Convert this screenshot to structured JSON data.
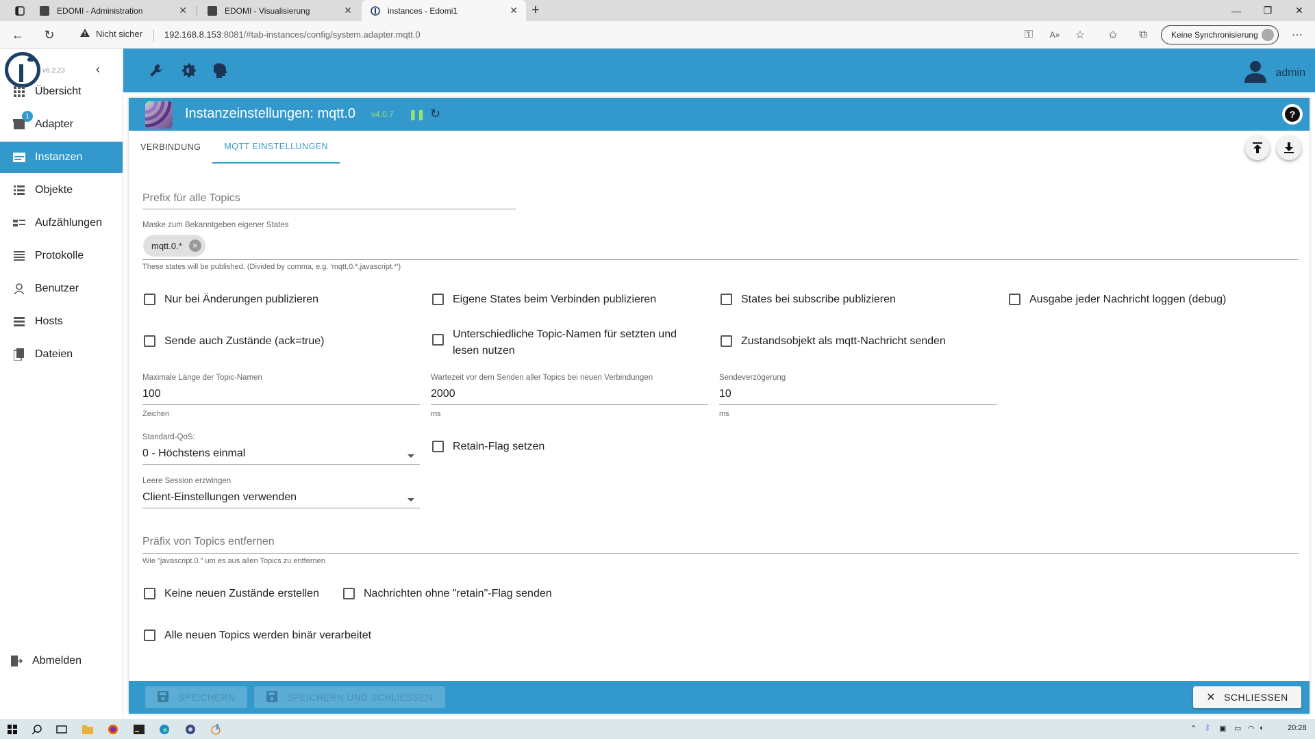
{
  "browser": {
    "tabs": [
      {
        "title": "EDOMI - Administration",
        "active": false
      },
      {
        "title": "EDOMI - Visualisierung",
        "active": false
      },
      {
        "title": "instances - Edomi1",
        "active": true
      }
    ],
    "address": {
      "security": "Nicht sicher",
      "host": "192.168.8.153",
      "path": ":8081/#tab-instances/config/system.adapter.mqtt.0"
    },
    "sync_label": "Keine Synchronisierung"
  },
  "sidebar": {
    "version": "v6.2.23",
    "items": [
      {
        "label": "Übersicht",
        "icon": "grid-icon"
      },
      {
        "label": "Adapter",
        "icon": "store-icon",
        "badge": "1"
      },
      {
        "label": "Instanzen",
        "icon": "instances-icon",
        "active": true
      },
      {
        "label": "Objekte",
        "icon": "list-icon"
      },
      {
        "label": "Aufzählungen",
        "icon": "enum-icon"
      },
      {
        "label": "Protokolle",
        "icon": "log-icon"
      },
      {
        "label": "Benutzer",
        "icon": "user-icon"
      },
      {
        "label": "Hosts",
        "icon": "hosts-icon"
      },
      {
        "label": "Dateien",
        "icon": "files-icon"
      }
    ],
    "logout": "Abmelden"
  },
  "appbar": {
    "user": "admin"
  },
  "dialog": {
    "title": "Instanzeinstellungen: mqtt.0",
    "version": "v4.0.7",
    "tabs": [
      "VERBINDUNG",
      "MQTT EINSTELLUNGEN"
    ],
    "active_tab": 1,
    "prefix_placeholder": "Prefix für alle Topics",
    "mask_label": "Maske zum Bekanntgeben eigener States",
    "mask_chip": "mqtt.0.*",
    "mask_helper": "These states will be published. (Divided by comma, e.g. 'mqtt.0.*,javascript.*')",
    "checkboxes_row1": [
      "Nur bei Änderungen publizieren",
      "Eigene States beim Verbinden publizieren",
      "States bei subscribe publizieren",
      "Ausgabe jeder Nachricht loggen (debug)"
    ],
    "checkboxes_row2": [
      "Sende auch Zustände (ack=true)",
      "Unterschiedliche Topic-Namen für setzten und lesen nutzen",
      "Zustandsobjekt als mqtt-Nachricht senden"
    ],
    "maxlen": {
      "label": "Maximale Länge der Topic-Namen",
      "value": "100",
      "unit": "Zeichen"
    },
    "wait": {
      "label": "Wartezeit vor dem Senden aller Topics bei neuen Verbindungen",
      "value": "2000",
      "unit": "ms"
    },
    "delay": {
      "label": "Sendeverzögerung",
      "value": "10",
      "unit": "ms"
    },
    "qos": {
      "label": "Standard-QoS:",
      "value": "0 - Höchstens einmal"
    },
    "retain": "Retain-Flag setzen",
    "session": {
      "label": "Leere Session erzwingen",
      "value": "Client-Einstellungen verwenden"
    },
    "remove_prefix_placeholder": "Präfix von Topics entfernen",
    "remove_prefix_helper": "Wie \"javascript.0.\" um es aus allen Topics zu entfernen",
    "checkboxes_row3": [
      "Keine neuen Zustände erstellen",
      "Nachrichten ohne \"retain\"-Flag senden"
    ],
    "checkbox_binary": "Alle neuen Topics werden binär verarbeitet",
    "footer": {
      "save": "SPEICHERN",
      "save_close": "SPEICHERN UND SCHLIESSEN",
      "close": "SCHLIESSEN"
    }
  },
  "taskbar": {
    "time": "20:28"
  }
}
